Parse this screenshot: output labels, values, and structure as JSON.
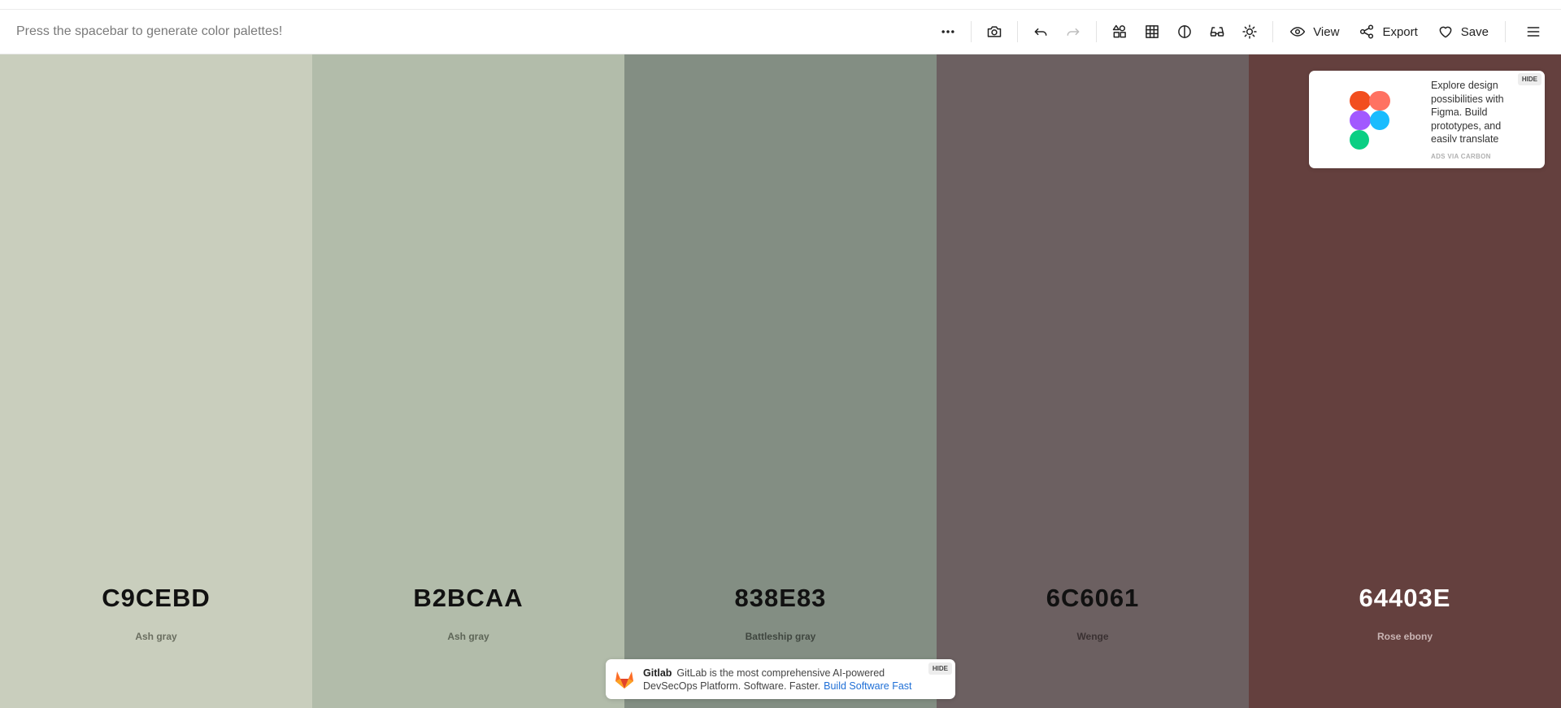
{
  "toolbar": {
    "hint": "Press the spacebar to generate color palettes!",
    "view_label": "View",
    "export_label": "Export",
    "save_label": "Save",
    "icons": [
      "more-icon",
      "camera-icon",
      "undo-icon",
      "redo-icon",
      "shapes-icon",
      "grid-icon",
      "contrast-icon",
      "glasses-icon",
      "sun-icon",
      "eye-icon",
      "share-icon",
      "heart-icon",
      "menu-icon"
    ]
  },
  "palette": [
    {
      "hex": "C9CEBD",
      "name": "Ash gray",
      "color": "#C9CEBD",
      "text_color": "#111111",
      "name_color": "#6a6e60"
    },
    {
      "hex": "B2BCAA",
      "name": "Ash gray",
      "color": "#B2BCAA",
      "text_color": "#111111",
      "name_color": "#5d6557"
    },
    {
      "hex": "838E83",
      "name": "Battleship gray",
      "color": "#838E83",
      "text_color": "#111111",
      "name_color": "#3f463f"
    },
    {
      "hex": "6C6061",
      "name": "Wenge",
      "color": "#6C6061",
      "text_color": "#111111",
      "name_color": "#3a3132"
    },
    {
      "hex": "64403E",
      "name": "Rose ebony",
      "color": "#64403E",
      "text_color": "#ffffff",
      "name_color": "#c9b5b4"
    }
  ],
  "ads": {
    "figma": {
      "text": "Explore design possibilities with Figma. Build prototypes, and easily translate your designs.",
      "via": "ADS VIA CARBON",
      "hide": "HIDE"
    },
    "gitlab": {
      "brand": "Gitlab",
      "text": "GitLab is the most comprehensive AI-powered DevSecOps Platform. Software. Faster.",
      "link": "Build Software Fast",
      "hide": "HIDE"
    }
  }
}
